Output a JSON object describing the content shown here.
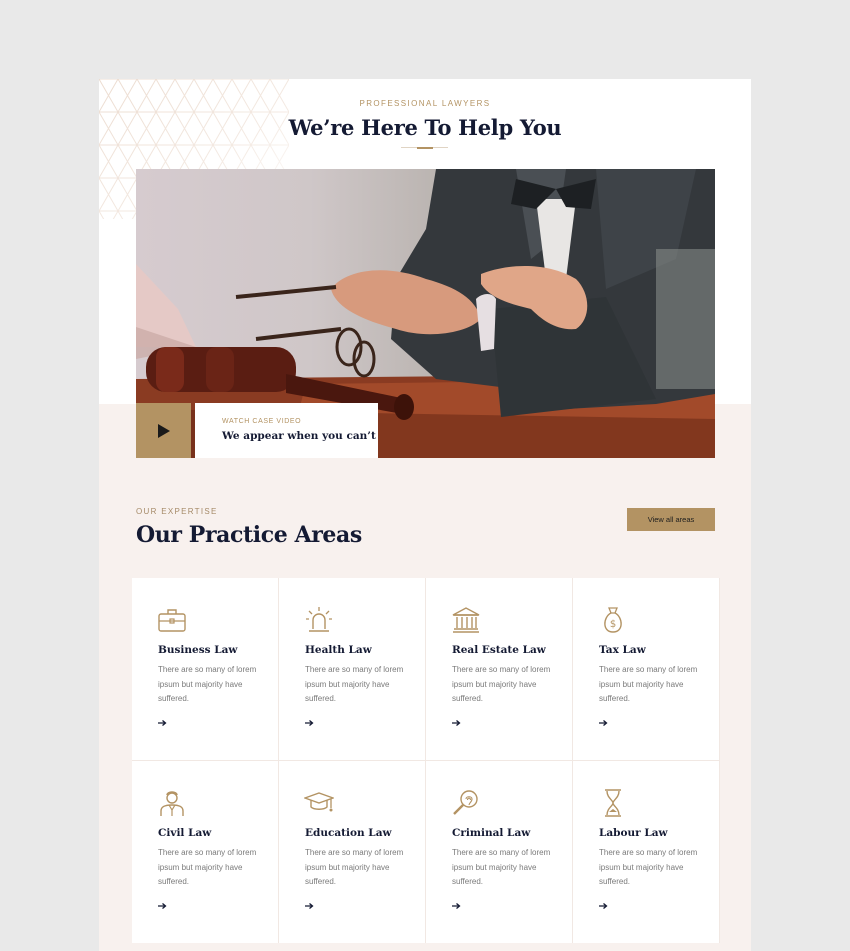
{
  "hero": {
    "eyebrow": "PROFESSIONAL LAWYERS",
    "title": "We’re Here To Help You"
  },
  "video": {
    "eyebrow": "WATCH CASE VIDEO",
    "title": "We appear when you can’t",
    "play_icon": "play-icon"
  },
  "practice": {
    "eyebrow": "OUR EXPERTISE",
    "title": "Our Practice Areas",
    "view_all_label": "View all areas",
    "cards": [
      {
        "icon": "briefcase-icon",
        "title": "Business Law",
        "text": "There are so many of lorem ipsum but majority have suffered."
      },
      {
        "icon": "siren-icon",
        "title": "Health Law",
        "text": "There are so many of lorem ipsum but majority have suffered."
      },
      {
        "icon": "courthouse-icon",
        "title": "Real Estate Law",
        "text": "There are so many of lorem ipsum but majority have suffered."
      },
      {
        "icon": "money-bag-icon",
        "title": "Tax Law",
        "text": "There are so many of lorem ipsum but majority have suffered."
      },
      {
        "icon": "lawyer-icon",
        "title": "Civil Law",
        "text": "There are so many of lorem ipsum but majority have suffered."
      },
      {
        "icon": "graduation-cap-icon",
        "title": "Education Law",
        "text": "There are so many of lorem ipsum but majority have suffered."
      },
      {
        "icon": "fingerprint-magnifier-icon",
        "title": "Criminal Law",
        "text": "There are so many of lorem ipsum but majority have suffered."
      },
      {
        "icon": "hourglass-icon",
        "title": "Labour Law",
        "text": "There are so many of lorem ipsum but majority have suffered."
      }
    ]
  },
  "colors": {
    "accent": "#b39363",
    "heading": "#141a33",
    "section_background": "#f8f1ee"
  }
}
